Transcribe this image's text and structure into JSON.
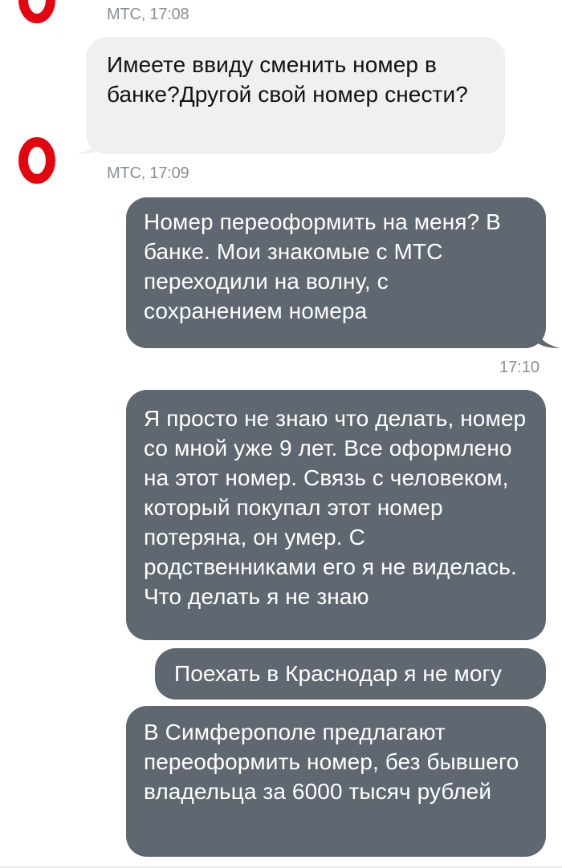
{
  "chat": {
    "messages": [
      {
        "direction": "incoming",
        "sender_time": "МТС, 17:08"
      },
      {
        "direction": "incoming",
        "text": "Имеете ввиду сменить номер в банке?Другой свой номер снести?",
        "sender_time": "МТС, 17:09"
      },
      {
        "direction": "outgoing",
        "text": "Номер переоформить на меня? В банке. Мои знакомые с МТС переходили на волну, с сохранением номера",
        "time": "17:10"
      },
      {
        "direction": "outgoing",
        "text": "Я просто не знаю что делать, номер со мной уже 9 лет. Все оформлено на этот номер. Связь с человеком, который покупал этот номер потеряна, он умер. С родственниками его я не виделась. Что делать я не знаю"
      },
      {
        "direction": "outgoing",
        "text": "Поехать в Краснодар я не могу"
      },
      {
        "direction": "outgoing",
        "text": "В Симферополе предлагают переоформить номер, без бывшего владельца за 6000 тысяч рублей"
      }
    ],
    "operator_avatar_icon": "mts-egg-logo",
    "colors": {
      "brand_red": "#e30611",
      "incoming_bubble": "#f0f0f2",
      "outgoing_bubble": "#5f6770",
      "meta_text": "#8a8f96"
    }
  }
}
